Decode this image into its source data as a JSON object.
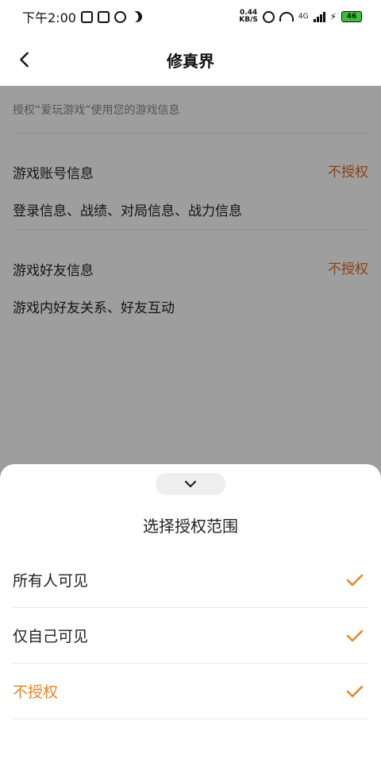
{
  "status_bar": {
    "time": "下午2:00",
    "speed_value": "0.44",
    "speed_unit": "KB/S",
    "network": "4G",
    "battery": "46"
  },
  "header": {
    "title": "修真界"
  },
  "intro": "授权“爱玩游戏”使用您的游戏信息",
  "permissions": [
    {
      "name": "游戏账号信息",
      "status": "不授权",
      "desc": "登录信息、战绩、对局信息、战力信息"
    },
    {
      "name": "游戏好友信息",
      "status": "不授权",
      "desc": "游戏内好友关系、好友互动"
    }
  ],
  "sheet": {
    "title": "选择授权范围",
    "options": [
      {
        "label": "所有人可见"
      },
      {
        "label": "仅自己可见"
      },
      {
        "label": "不授权"
      }
    ]
  },
  "colors": {
    "accent": "#e88422",
    "status_text": "#e06b22"
  }
}
